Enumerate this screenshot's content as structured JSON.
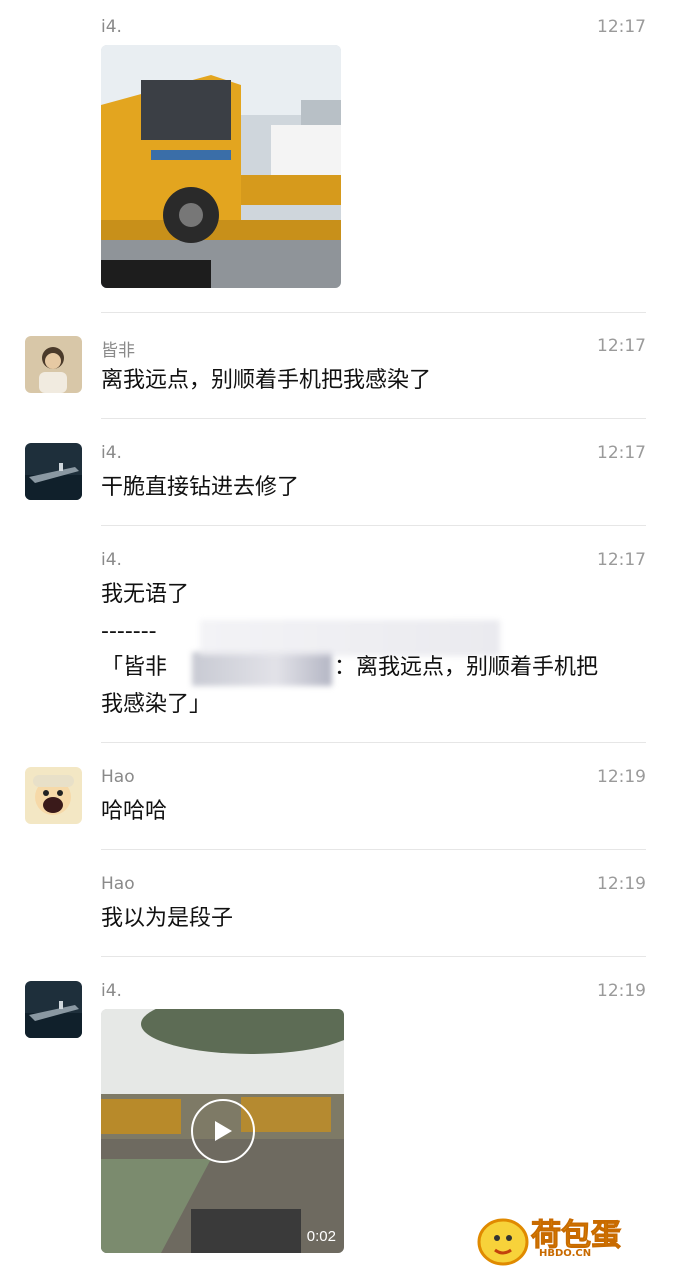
{
  "messages": [
    {
      "sender": "i4.",
      "time": "12:17",
      "type": "image"
    },
    {
      "sender": "皆非",
      "time": "12:17",
      "text": "离我远点，别顺着手机把我感染了"
    },
    {
      "sender": "i4.",
      "time": "12:17",
      "text": "干脆直接钻进去修了"
    },
    {
      "sender": "i4.",
      "time": "12:17",
      "line1": "我无语了",
      "line2": "-------",
      "quote_a": "「皆非",
      "quote_b": "：离我远点，别顺着手机把",
      "quote_c": "我感染了」"
    },
    {
      "sender": "Hao",
      "time": "12:19",
      "text": "哈哈哈"
    },
    {
      "sender": "Hao",
      "time": "12:19",
      "text": "我以为是段子"
    },
    {
      "sender": "i4.",
      "time": "12:19",
      "type": "video",
      "duration": "0:02"
    }
  ],
  "watermark": {
    "main": "荷包蛋",
    "sub": "HBDO.CN"
  },
  "colors": {
    "truck": "#e3a51f",
    "accent_logo": "#f2a900"
  },
  "icons": [
    "person-avatar-icon",
    "aircraft-carrier-avatar-icon",
    "anime-avatar-icon",
    "play-icon"
  ]
}
